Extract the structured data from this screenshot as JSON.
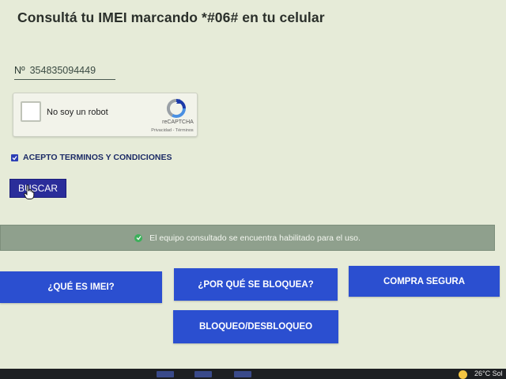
{
  "title": "Consultá tu IMEI marcando *#06# en tu celular",
  "imei": {
    "prefix": "Nº",
    "value": "354835094449"
  },
  "captcha": {
    "label": "No soy un robot",
    "brand": "reCAPTCHA",
    "links": "Privacidad - Términos"
  },
  "terms": {
    "label": "ACEPTO TERMINOS Y CONDICIONES",
    "checked": true
  },
  "search_button": "BUSCAR",
  "status": {
    "message": "El equipo consultado se encuentra habilitado para el uso.",
    "color": "#3bb05a"
  },
  "nav": {
    "what_is_imei": "¿QUÉ ES IMEI?",
    "why_blocked": "¿POR QUÉ SE BLOQUEA?",
    "safe_purchase": "COMPRA SEGURA",
    "block_unblock": "BLOQUEO/DESBLOQUEO"
  },
  "taskbar": {
    "weather": "26°C Sol"
  },
  "colors": {
    "button_blue": "#2b4fd0",
    "search_button": "#2a2d9a",
    "status_bar": "#8fa08d",
    "text_navy": "#1c2b66"
  }
}
